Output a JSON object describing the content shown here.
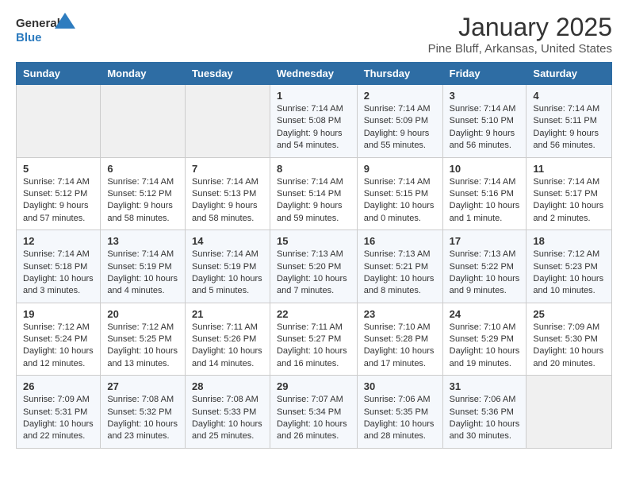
{
  "logo": {
    "line1": "General",
    "line2": "Blue"
  },
  "title": "January 2025",
  "subtitle": "Pine Bluff, Arkansas, United States",
  "days_of_week": [
    "Sunday",
    "Monday",
    "Tuesday",
    "Wednesday",
    "Thursday",
    "Friday",
    "Saturday"
  ],
  "weeks": [
    [
      {
        "day": null
      },
      {
        "day": null
      },
      {
        "day": null
      },
      {
        "day": "1",
        "sunrise": "7:14 AM",
        "sunset": "5:08 PM",
        "daylight": "9 hours and 54 minutes."
      },
      {
        "day": "2",
        "sunrise": "7:14 AM",
        "sunset": "5:09 PM",
        "daylight": "9 hours and 55 minutes."
      },
      {
        "day": "3",
        "sunrise": "7:14 AM",
        "sunset": "5:10 PM",
        "daylight": "9 hours and 56 minutes."
      },
      {
        "day": "4",
        "sunrise": "7:14 AM",
        "sunset": "5:11 PM",
        "daylight": "9 hours and 56 minutes."
      }
    ],
    [
      {
        "day": "5",
        "sunrise": "7:14 AM",
        "sunset": "5:12 PM",
        "daylight": "9 hours and 57 minutes."
      },
      {
        "day": "6",
        "sunrise": "7:14 AM",
        "sunset": "5:12 PM",
        "daylight": "9 hours and 58 minutes."
      },
      {
        "day": "7",
        "sunrise": "7:14 AM",
        "sunset": "5:13 PM",
        "daylight": "9 hours and 58 minutes."
      },
      {
        "day": "8",
        "sunrise": "7:14 AM",
        "sunset": "5:14 PM",
        "daylight": "9 hours and 59 minutes."
      },
      {
        "day": "9",
        "sunrise": "7:14 AM",
        "sunset": "5:15 PM",
        "daylight": "10 hours and 0 minutes."
      },
      {
        "day": "10",
        "sunrise": "7:14 AM",
        "sunset": "5:16 PM",
        "daylight": "10 hours and 1 minute."
      },
      {
        "day": "11",
        "sunrise": "7:14 AM",
        "sunset": "5:17 PM",
        "daylight": "10 hours and 2 minutes."
      }
    ],
    [
      {
        "day": "12",
        "sunrise": "7:14 AM",
        "sunset": "5:18 PM",
        "daylight": "10 hours and 3 minutes."
      },
      {
        "day": "13",
        "sunrise": "7:14 AM",
        "sunset": "5:19 PM",
        "daylight": "10 hours and 4 minutes."
      },
      {
        "day": "14",
        "sunrise": "7:14 AM",
        "sunset": "5:19 PM",
        "daylight": "10 hours and 5 minutes."
      },
      {
        "day": "15",
        "sunrise": "7:13 AM",
        "sunset": "5:20 PM",
        "daylight": "10 hours and 7 minutes."
      },
      {
        "day": "16",
        "sunrise": "7:13 AM",
        "sunset": "5:21 PM",
        "daylight": "10 hours and 8 minutes."
      },
      {
        "day": "17",
        "sunrise": "7:13 AM",
        "sunset": "5:22 PM",
        "daylight": "10 hours and 9 minutes."
      },
      {
        "day": "18",
        "sunrise": "7:12 AM",
        "sunset": "5:23 PM",
        "daylight": "10 hours and 10 minutes."
      }
    ],
    [
      {
        "day": "19",
        "sunrise": "7:12 AM",
        "sunset": "5:24 PM",
        "daylight": "10 hours and 12 minutes."
      },
      {
        "day": "20",
        "sunrise": "7:12 AM",
        "sunset": "5:25 PM",
        "daylight": "10 hours and 13 minutes."
      },
      {
        "day": "21",
        "sunrise": "7:11 AM",
        "sunset": "5:26 PM",
        "daylight": "10 hours and 14 minutes."
      },
      {
        "day": "22",
        "sunrise": "7:11 AM",
        "sunset": "5:27 PM",
        "daylight": "10 hours and 16 minutes."
      },
      {
        "day": "23",
        "sunrise": "7:10 AM",
        "sunset": "5:28 PM",
        "daylight": "10 hours and 17 minutes."
      },
      {
        "day": "24",
        "sunrise": "7:10 AM",
        "sunset": "5:29 PM",
        "daylight": "10 hours and 19 minutes."
      },
      {
        "day": "25",
        "sunrise": "7:09 AM",
        "sunset": "5:30 PM",
        "daylight": "10 hours and 20 minutes."
      }
    ],
    [
      {
        "day": "26",
        "sunrise": "7:09 AM",
        "sunset": "5:31 PM",
        "daylight": "10 hours and 22 minutes."
      },
      {
        "day": "27",
        "sunrise": "7:08 AM",
        "sunset": "5:32 PM",
        "daylight": "10 hours and 23 minutes."
      },
      {
        "day": "28",
        "sunrise": "7:08 AM",
        "sunset": "5:33 PM",
        "daylight": "10 hours and 25 minutes."
      },
      {
        "day": "29",
        "sunrise": "7:07 AM",
        "sunset": "5:34 PM",
        "daylight": "10 hours and 26 minutes."
      },
      {
        "day": "30",
        "sunrise": "7:06 AM",
        "sunset": "5:35 PM",
        "daylight": "10 hours and 28 minutes."
      },
      {
        "day": "31",
        "sunrise": "7:06 AM",
        "sunset": "5:36 PM",
        "daylight": "10 hours and 30 minutes."
      },
      {
        "day": null
      }
    ]
  ],
  "labels": {
    "sunrise": "Sunrise:",
    "sunset": "Sunset:",
    "daylight": "Daylight:"
  }
}
